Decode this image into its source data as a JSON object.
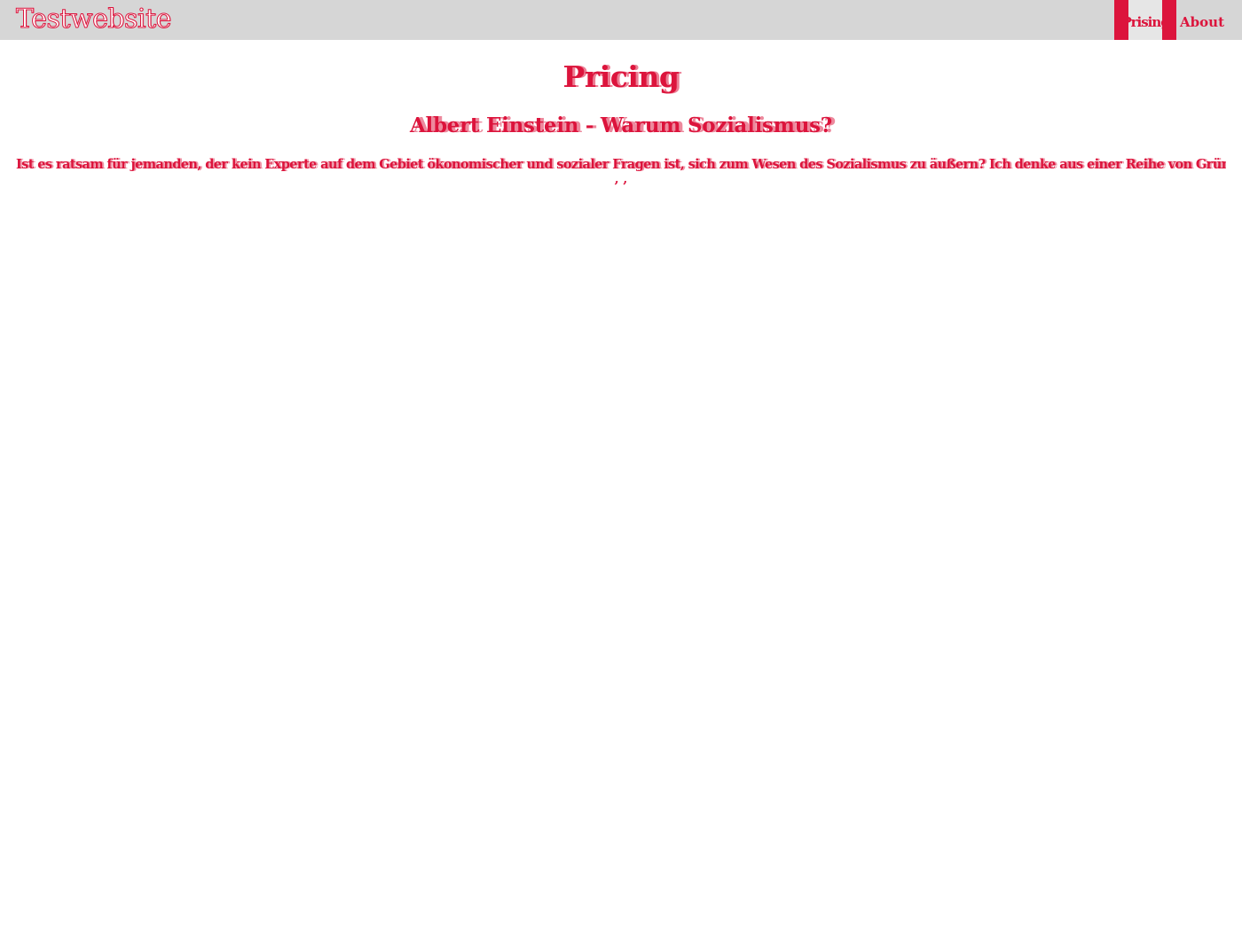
{
  "header": {
    "brand": "Testwebsite",
    "nav": [
      {
        "label": "Prising",
        "active": true
      },
      {
        "label": "About",
        "active": false
      }
    ]
  },
  "main": {
    "title": "Pricing",
    "subtitle": "Albert Einstein - Warum Sozialismus?",
    "paragraph": "Ist es ratsam für jemanden, der kein Experte auf dem Gebiet ökonomischer und sozialer Fragen ist, sich zum Wesen des Sozialismus zu äußern? Ich denke aus einer Reihe von Gründen, dass dies der Fall ist.",
    "paragraph_tail": ", ,"
  },
  "colors": {
    "accent": "#dc143c",
    "header_background": "#d6d6d6",
    "active_nav_background": "#e6e6e6",
    "page_background": "#ffffff"
  }
}
